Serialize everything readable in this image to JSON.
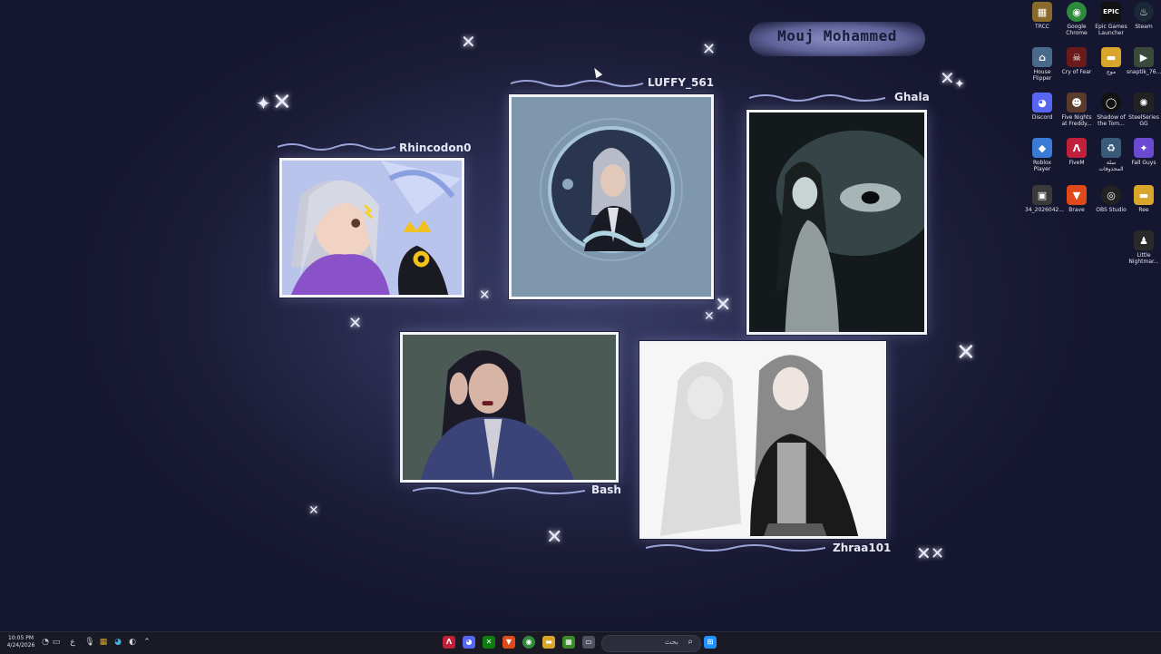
{
  "wallpaper": {
    "title": "Mouj Mohammed",
    "artworks": [
      {
        "artist": "Rhincodon0"
      },
      {
        "artist": "LUFFY_561"
      },
      {
        "artist": "Ghala"
      },
      {
        "artist": "Bash"
      },
      {
        "artist": "Zhraa101"
      }
    ]
  },
  "desktop_icons": [
    {
      "label": "TRCC",
      "icon": "trcc-icon",
      "color": "#8a6a2a",
      "glyph": "▦"
    },
    {
      "label": "Google Chrome",
      "icon": "chrome-icon",
      "color": "#2e8b3e",
      "glyph": "◉"
    },
    {
      "label": "Epic Games Launcher",
      "icon": "epic-games-icon",
      "color": "#111111",
      "glyph": "EPIC"
    },
    {
      "label": "Steam",
      "icon": "steam-icon",
      "color": "#1b2838",
      "glyph": "♨"
    },
    {
      "label": "House Flipper",
      "icon": "house-flipper-icon",
      "color": "#4a6a8a",
      "glyph": "⌂"
    },
    {
      "label": "Cry of Fear",
      "icon": "cry-of-fear-icon",
      "color": "#6a1a1a",
      "glyph": "☠"
    },
    {
      "label": "موج",
      "icon": "folder-icon",
      "color": "#d9a52a",
      "glyph": "▬"
    },
    {
      "label": "snaptik_76...",
      "icon": "video-file-icon",
      "color": "#3a4a3a",
      "glyph": "▶"
    },
    {
      "label": "Discord",
      "icon": "discord-icon",
      "color": "#5865f2",
      "glyph": "◕"
    },
    {
      "label": "Five Nights at Freddy...",
      "icon": "fnaf-icon",
      "color": "#5a3a2a",
      "glyph": "☻"
    },
    {
      "label": "Shadow of the Tom...",
      "icon": "shadow-tomb-raider-icon",
      "color": "#111111",
      "glyph": "◯"
    },
    {
      "label": "SteelSeries GG",
      "icon": "steelseries-icon",
      "color": "#222222",
      "glyph": "✺"
    },
    {
      "label": "Roblox Player",
      "icon": "roblox-icon",
      "color": "#3a7bd5",
      "glyph": "◆"
    },
    {
      "label": "FiveM",
      "icon": "fivem-icon",
      "color": "#c0203a",
      "glyph": "Λ"
    },
    {
      "label": "سلة المحذوفات",
      "icon": "recycle-bin-icon",
      "color": "#3a5a7a",
      "glyph": "♻"
    },
    {
      "label": "Fall Guys",
      "icon": "fall-guys-icon",
      "color": "#6a4ad0",
      "glyph": "✦"
    },
    {
      "label": "34_2026042...",
      "icon": "image-file-icon",
      "color": "#3a3a3a",
      "glyph": "▣"
    },
    {
      "label": "Brave",
      "icon": "brave-icon",
      "color": "#e04a1a",
      "glyph": "▼"
    },
    {
      "label": "OBS Studio",
      "icon": "obs-icon",
      "color": "#222222",
      "glyph": "◎"
    },
    {
      "label": "Ree",
      "icon": "folder-icon",
      "color": "#d9a52a",
      "glyph": "▬"
    },
    {
      "label": "Little Nightmar...",
      "icon": "little-nightmares-icon",
      "color": "#2a2a2a",
      "glyph": "♟"
    }
  ],
  "taskbar": {
    "time": "10:05 PM",
    "date": "4/24/2026",
    "search_placeholder": "بحث",
    "lang": "ع",
    "pinned": [
      {
        "name": "fivem",
        "color": "#c0203a",
        "glyph": "Λ"
      },
      {
        "name": "discord",
        "color": "#5865f2",
        "glyph": "◕"
      },
      {
        "name": "xbox",
        "color": "#107c10",
        "glyph": "✕"
      },
      {
        "name": "brave",
        "color": "#e04a1a",
        "glyph": "▼"
      },
      {
        "name": "chrome",
        "color": "#2e8b3e",
        "glyph": "◉"
      },
      {
        "name": "file-explorer",
        "color": "#d9a52a",
        "glyph": "▬"
      },
      {
        "name": "minecraft",
        "color": "#3a8a2a",
        "glyph": "▦"
      },
      {
        "name": "taskview",
        "color": "#505060",
        "glyph": "▭"
      }
    ]
  }
}
